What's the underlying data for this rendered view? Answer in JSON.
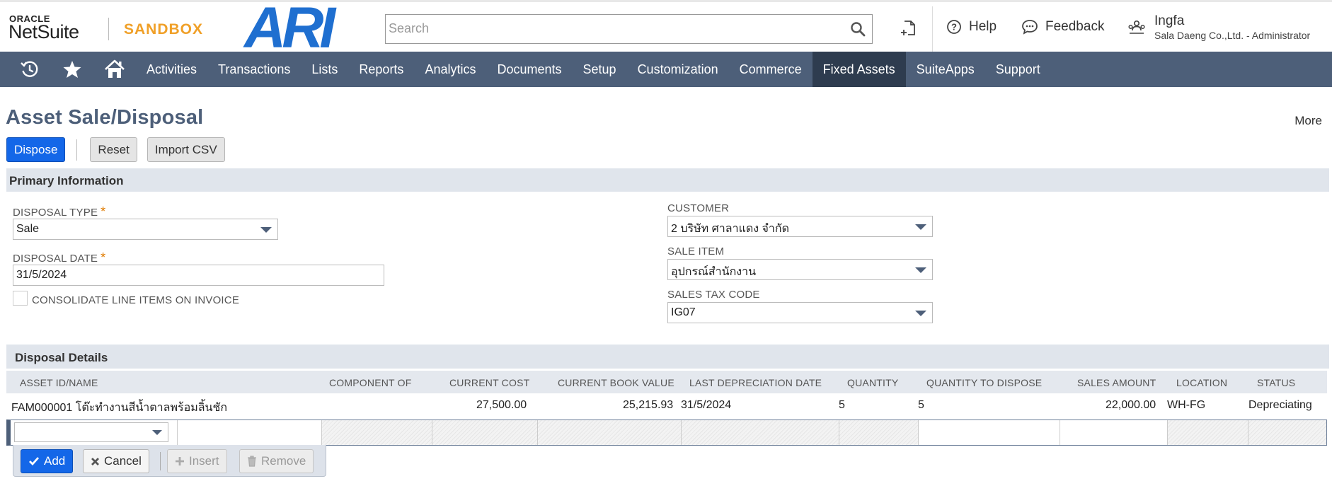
{
  "header": {
    "oracle_label": "ORACLE",
    "netsuite_label": "NetSuite",
    "sandbox_label": "SANDBOX",
    "company_logo_text": "ARI",
    "search_placeholder": "Search",
    "help_label": "Help",
    "feedback_label": "Feedback",
    "user_name": "Ingfa",
    "user_role": "Sala Daeng Co.,Ltd. - Administrator"
  },
  "nav": {
    "items": [
      "Activities",
      "Transactions",
      "Lists",
      "Reports",
      "Analytics",
      "Documents",
      "Setup",
      "Customization",
      "Commerce",
      "Fixed Assets",
      "SuiteApps",
      "Support"
    ],
    "active": "Fixed Assets"
  },
  "page": {
    "title": "Asset Sale/Disposal",
    "more_label": "More",
    "buttons": {
      "dispose": "Dispose",
      "reset": "Reset",
      "import_csv": "Import CSV"
    }
  },
  "primary": {
    "section_title": "Primary Information",
    "disposal_type": {
      "label": "DISPOSAL TYPE",
      "required_mark": "*",
      "value": "Sale"
    },
    "disposal_date": {
      "label": "DISPOSAL DATE",
      "required_mark": "*",
      "value": "31/5/2024"
    },
    "consolidate_label": "CONSOLIDATE LINE ITEMS ON INVOICE",
    "customer": {
      "label": "CUSTOMER",
      "value": "2 บริษัท ศาลาแดง จำกัด"
    },
    "sale_item": {
      "label": "SALE ITEM",
      "value": "อุปกรณ์สำนักงาน"
    },
    "sales_tax_code": {
      "label": "SALES TAX CODE",
      "value": "IG07"
    }
  },
  "details": {
    "tab_label": "Disposal Details",
    "columns": {
      "asset": "ASSET ID/NAME",
      "component": "COMPONENT OF",
      "current_cost": "CURRENT COST",
      "book_value": "CURRENT BOOK VALUE",
      "last_dep": "LAST DEPRECIATION DATE",
      "quantity": "QUANTITY",
      "qty_dispose": "QUANTITY TO DISPOSE",
      "sales_amount": "SALES AMOUNT",
      "location": "LOCATION",
      "status": "STATUS"
    },
    "row": {
      "asset": "FAM000001 โต๊ะทำงานสีน้ำตาลพร้อมลิ้นชัก",
      "component": "",
      "current_cost": "27,500.00",
      "book_value": "25,215.93",
      "last_dep": "31/5/2024",
      "quantity": "5",
      "qty_dispose": "5",
      "sales_amount": "22,000.00",
      "location": "WH-FG",
      "status": "Depreciating"
    },
    "actions": {
      "add": "Add",
      "cancel": "Cancel",
      "insert": "Insert",
      "remove": "Remove"
    }
  }
}
